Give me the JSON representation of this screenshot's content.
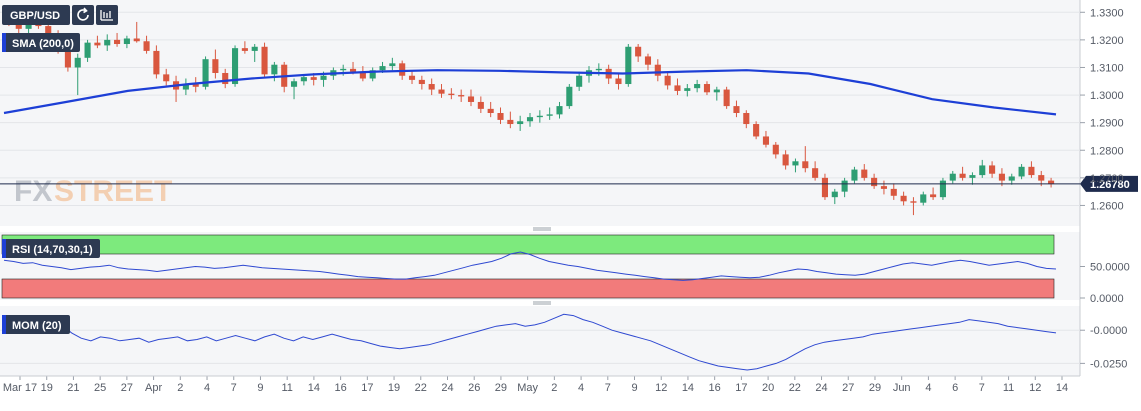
{
  "header": {
    "symbol": "GBP/USD",
    "refresh_icon": "refresh-icon",
    "calendar_icon": "calendar-icon"
  },
  "watermark": {
    "text_fx": "FX",
    "text_street": "STREET"
  },
  "indicators": {
    "sma_label": "SMA (200,0)",
    "rsi_label": "RSI (14,70,30,1)",
    "mom_label": "MOM (20)"
  },
  "colors": {
    "up": "#2e9e73",
    "down": "#d9573f",
    "sma": "#1d3fd6",
    "rsi_line": "#2f49d1",
    "mom_line": "#2f49d1",
    "overbought_zone": "#7dea7d",
    "oversold_zone": "#f27b7b",
    "price_tag": "#1e2b4d",
    "badge": "#2d3a52"
  },
  "chart_data": [
    {
      "type": "candlestick",
      "title": "GBP/USD",
      "current_price": 1.2678,
      "current_price_label": "1.26780",
      "y_ticks": [
        "1.3300",
        "1.3200",
        "1.3100",
        "1.3000",
        "1.2900",
        "1.2800",
        "1.2700",
        "1.2600"
      ],
      "ylim": [
        1.254,
        1.333
      ],
      "x_tick_labels": [
        "Mar 17",
        "19",
        "21",
        "25",
        "27",
        "Apr",
        "2",
        "4",
        "7",
        "9",
        "11",
        "14",
        "16",
        "17",
        "19",
        "22",
        "24",
        "26",
        "29",
        "May",
        "2",
        "4",
        "7",
        "9",
        "12",
        "14",
        "16",
        "17",
        "20",
        "22",
        "24",
        "27",
        "29",
        "Jun",
        "4",
        "6",
        "7",
        "11",
        "12",
        "14"
      ],
      "sma": {
        "name": "SMA (200,0)",
        "values": [
          1.2935,
          1.2975,
          1.3015,
          1.304,
          1.306,
          1.3075,
          1.3085,
          1.309,
          1.3088,
          1.3082,
          1.3078,
          1.3085,
          1.309,
          1.3078,
          1.304,
          1.2985,
          1.2955,
          1.293
        ]
      },
      "ohlc": [
        [
          1.3285,
          1.3305,
          1.325,
          1.3265
        ],
        [
          1.3265,
          1.329,
          1.3225,
          1.324
        ],
        [
          1.324,
          1.3275,
          1.322,
          1.3258
        ],
        [
          1.3258,
          1.3285,
          1.324,
          1.325
        ],
        [
          1.325,
          1.327,
          1.32,
          1.321
        ],
        [
          1.321,
          1.3235,
          1.315,
          1.3165
        ],
        [
          1.3165,
          1.319,
          1.3085,
          1.31
        ],
        [
          1.31,
          1.315,
          1.3,
          1.3135
        ],
        [
          1.3135,
          1.32,
          1.312,
          1.319
        ],
        [
          1.319,
          1.3215,
          1.317,
          1.318
        ],
        [
          1.318,
          1.322,
          1.316,
          1.32
        ],
        [
          1.32,
          1.3225,
          1.3175,
          1.3185
        ],
        [
          1.3185,
          1.3215,
          1.317,
          1.3205
        ],
        [
          1.3205,
          1.3265,
          1.319,
          1.3195
        ],
        [
          1.3195,
          1.3215,
          1.315,
          1.316
        ],
        [
          1.316,
          1.318,
          1.306,
          1.3075
        ],
        [
          1.3075,
          1.3095,
          1.3035,
          1.305
        ],
        [
          1.305,
          1.307,
          1.2975,
          1.302
        ],
        [
          1.302,
          1.306,
          1.3,
          1.304
        ],
        [
          1.304,
          1.3065,
          1.301,
          1.303
        ],
        [
          1.303,
          1.314,
          1.302,
          1.313
        ],
        [
          1.313,
          1.3165,
          1.306,
          1.308
        ],
        [
          1.308,
          1.3095,
          1.3025,
          1.304
        ],
        [
          1.304,
          1.318,
          1.303,
          1.317
        ],
        [
          1.317,
          1.3195,
          1.315,
          1.316
        ],
        [
          1.316,
          1.3185,
          1.312,
          1.3175
        ],
        [
          1.3175,
          1.319,
          1.306,
          1.3075
        ],
        [
          1.3075,
          1.312,
          1.305,
          1.311
        ],
        [
          1.311,
          1.312,
          1.301,
          1.303
        ],
        [
          1.303,
          1.306,
          1.2985,
          1.305
        ],
        [
          1.305,
          1.3075,
          1.3035,
          1.3065
        ],
        [
          1.3065,
          1.308,
          1.3035,
          1.3055
        ],
        [
          1.3055,
          1.3085,
          1.303,
          1.307
        ],
        [
          1.307,
          1.31,
          1.3055,
          1.309
        ],
        [
          1.309,
          1.311,
          1.307,
          1.3095
        ],
        [
          1.3095,
          1.312,
          1.3075,
          1.3085
        ],
        [
          1.3085,
          1.3105,
          1.305,
          1.306
        ],
        [
          1.306,
          1.31,
          1.305,
          1.309
        ],
        [
          1.309,
          1.312,
          1.308,
          1.3105
        ],
        [
          1.3105,
          1.3135,
          1.309,
          1.3115
        ],
        [
          1.3115,
          1.3125,
          1.3055,
          1.307
        ],
        [
          1.307,
          1.309,
          1.304,
          1.3055
        ],
        [
          1.3055,
          1.307,
          1.302,
          1.304
        ],
        [
          1.304,
          1.306,
          1.3,
          1.302
        ],
        [
          1.302,
          1.304,
          1.299,
          1.3005
        ],
        [
          1.3005,
          1.3025,
          1.2985,
          1.3
        ],
        [
          1.3,
          1.302,
          1.2975,
          1.2995
        ],
        [
          1.2995,
          1.302,
          1.296,
          1.2975
        ],
        [
          1.2975,
          1.2995,
          1.2935,
          1.295
        ],
        [
          1.295,
          1.2975,
          1.292,
          1.2935
        ],
        [
          1.2935,
          1.2955,
          1.2895,
          1.291
        ],
        [
          1.291,
          1.294,
          1.288,
          1.2895
        ],
        [
          1.2895,
          1.2925,
          1.287,
          1.2905
        ],
        [
          1.2905,
          1.2935,
          1.2885,
          1.292
        ],
        [
          1.292,
          1.2945,
          1.29,
          1.2925
        ],
        [
          1.2925,
          1.2955,
          1.291,
          1.293
        ],
        [
          1.293,
          1.2975,
          1.2915,
          1.296
        ],
        [
          1.296,
          1.304,
          1.295,
          1.303
        ],
        [
          1.303,
          1.3085,
          1.3015,
          1.307
        ],
        [
          1.307,
          1.3105,
          1.3045,
          1.309
        ],
        [
          1.309,
          1.3115,
          1.307,
          1.3095
        ],
        [
          1.3095,
          1.311,
          1.304,
          1.306
        ],
        [
          1.306,
          1.308,
          1.302,
          1.304
        ],
        [
          1.304,
          1.3185,
          1.303,
          1.3175
        ],
        [
          1.3175,
          1.3185,
          1.312,
          1.314
        ],
        [
          1.314,
          1.315,
          1.309,
          1.311
        ],
        [
          1.311,
          1.313,
          1.305,
          1.307
        ],
        [
          1.307,
          1.3085,
          1.302,
          1.3035
        ],
        [
          1.3035,
          1.306,
          1.3,
          1.3015
        ],
        [
          1.3015,
          1.304,
          1.2995,
          1.3025
        ],
        [
          1.3025,
          1.3055,
          1.301,
          1.304
        ],
        [
          1.304,
          1.305,
          1.3,
          1.301
        ],
        [
          1.301,
          1.303,
          1.298,
          1.302
        ],
        [
          1.302,
          1.303,
          1.295,
          1.296
        ],
        [
          1.296,
          1.298,
          1.292,
          1.2935
        ],
        [
          1.2935,
          1.2945,
          1.288,
          1.2895
        ],
        [
          1.2895,
          1.2905,
          1.284,
          1.285
        ],
        [
          1.285,
          1.287,
          1.281,
          1.282
        ],
        [
          1.282,
          1.283,
          1.277,
          1.2785
        ],
        [
          1.2785,
          1.28,
          1.273,
          1.2745
        ],
        [
          1.2745,
          1.277,
          1.272,
          1.276
        ],
        [
          1.276,
          1.2815,
          1.272,
          1.2735
        ],
        [
          1.2735,
          1.276,
          1.269,
          1.27
        ],
        [
          1.27,
          1.2715,
          1.262,
          1.263
        ],
        [
          1.263,
          1.266,
          1.2605,
          1.265
        ],
        [
          1.265,
          1.27,
          1.263,
          1.269
        ],
        [
          1.269,
          1.274,
          1.268,
          1.273
        ],
        [
          1.273,
          1.275,
          1.269,
          1.27
        ],
        [
          1.27,
          1.2715,
          1.266,
          1.267
        ],
        [
          1.267,
          1.269,
          1.264,
          1.266
        ],
        [
          1.266,
          1.268,
          1.262,
          1.2635
        ],
        [
          1.2635,
          1.265,
          1.26,
          1.2615
        ],
        [
          1.2615,
          1.263,
          1.2565,
          1.261
        ],
        [
          1.261,
          1.265,
          1.26,
          1.264
        ],
        [
          1.264,
          1.2665,
          1.262,
          1.263
        ],
        [
          1.263,
          1.27,
          1.262,
          1.269
        ],
        [
          1.269,
          1.2725,
          1.268,
          1.2715
        ],
        [
          1.2715,
          1.274,
          1.269,
          1.27
        ],
        [
          1.27,
          1.272,
          1.2675,
          1.271
        ],
        [
          1.271,
          1.2765,
          1.27,
          1.2745
        ],
        [
          1.2745,
          1.276,
          1.27,
          1.2715
        ],
        [
          1.2715,
          1.2735,
          1.267,
          1.269
        ],
        [
          1.269,
          1.2715,
          1.2675,
          1.2705
        ],
        [
          1.2705,
          1.275,
          1.2695,
          1.274
        ],
        [
          1.274,
          1.276,
          1.27,
          1.271
        ],
        [
          1.271,
          1.2725,
          1.267,
          1.269
        ],
        [
          1.269,
          1.27,
          1.2665,
          1.2678
        ]
      ]
    },
    {
      "type": "line",
      "title": "RSI (14,70,30,1)",
      "y_ticks": [
        "50.0000",
        "0.0000"
      ],
      "ylim": [
        0,
        100
      ],
      "bands": {
        "overbought": 70,
        "oversold": 30
      },
      "values": [
        60,
        58,
        55,
        56,
        52,
        50,
        48,
        45,
        47,
        49,
        50,
        52,
        48,
        46,
        45,
        44,
        42,
        44,
        46,
        48,
        50,
        49,
        47,
        48,
        50,
        52,
        50,
        48,
        47,
        46,
        45,
        44,
        43,
        42,
        40,
        38,
        36,
        34,
        33,
        32,
        31,
        30,
        30,
        32,
        34,
        36,
        40,
        44,
        48,
        52,
        55,
        58,
        63,
        70,
        73,
        69,
        63,
        58,
        55,
        52,
        50,
        47,
        44,
        42,
        40,
        38,
        36,
        34,
        32,
        30,
        29,
        28,
        29,
        31,
        33,
        35,
        34,
        33,
        32,
        33,
        36,
        40,
        43,
        46,
        45,
        42,
        40,
        38,
        37,
        36,
        38,
        42,
        46,
        50,
        54,
        56,
        54,
        52,
        55,
        58,
        60,
        58,
        55,
        52,
        54,
        56,
        58,
        55,
        50,
        47,
        46
      ]
    },
    {
      "type": "line",
      "title": "MOM (20)",
      "y_ticks": [
        "-0.0000",
        "-0.0250"
      ],
      "ylim": [
        -0.033,
        0.016
      ],
      "values": [
        0.002,
        0.004,
        0.006,
        0.008,
        0.01,
        0.007,
        0.004,
        -0.002,
        -0.006,
        -0.008,
        -0.005,
        -0.006,
        -0.008,
        -0.007,
        -0.006,
        -0.009,
        -0.007,
        -0.006,
        -0.005,
        -0.008,
        -0.007,
        -0.005,
        -0.008,
        -0.006,
        -0.004,
        -0.006,
        -0.008,
        -0.005,
        -0.003,
        -0.006,
        -0.008,
        -0.005,
        -0.007,
        -0.005,
        -0.003,
        -0.005,
        -0.007,
        -0.008,
        -0.01,
        -0.012,
        -0.013,
        -0.014,
        -0.013,
        -0.012,
        -0.011,
        -0.009,
        -0.007,
        -0.005,
        -0.003,
        -0.001,
        0.001,
        0.003,
        0.004,
        0.005,
        0.003,
        0.004,
        0.006,
        0.009,
        0.012,
        0.011,
        0.008,
        0.006,
        0.003,
        0.0,
        -0.002,
        -0.004,
        -0.006,
        -0.008,
        -0.011,
        -0.014,
        -0.017,
        -0.02,
        -0.023,
        -0.025,
        -0.027,
        -0.028,
        -0.029,
        -0.03,
        -0.029,
        -0.027,
        -0.025,
        -0.022,
        -0.018,
        -0.014,
        -0.011,
        -0.009,
        -0.008,
        -0.007,
        -0.006,
        -0.005,
        -0.003,
        -0.002,
        -0.001,
        0.0,
        0.001,
        0.002,
        0.003,
        0.004,
        0.005,
        0.006,
        0.008,
        0.007,
        0.006,
        0.005,
        0.003,
        0.002,
        0.001,
        0.0,
        -0.001,
        -0.002
      ]
    }
  ]
}
